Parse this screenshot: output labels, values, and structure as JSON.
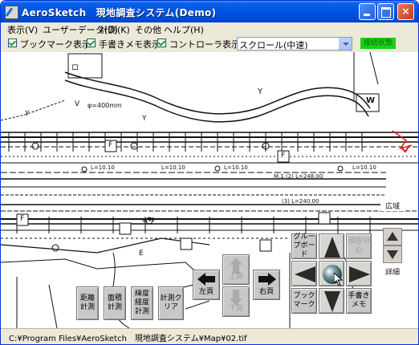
{
  "window": {
    "title": "AeroSketch　現地調査システム(Demo)",
    "controls": {
      "minimize": "minimize",
      "maximize": "maximize",
      "close": "×"
    }
  },
  "menu": [
    "表示(V)",
    "ユーザーデータ(D)",
    "計測(K)",
    "その他",
    "ヘルプ(H)"
  ],
  "toolbar": {
    "bookmark_show": "ブックマーク表示",
    "handwritten_memo_show": "手書きメモ表示",
    "controller_show": "コントローラ表示",
    "scroll_mode": "スクロール(中速)",
    "status_lamp": "接続状態"
  },
  "map": {
    "labels": {
      "y1": "Y",
      "y2": "Y",
      "y3": "Y",
      "w": "W",
      "v": "V",
      "f1": "F",
      "f2": "F",
      "f3": "F",
      "e": "E",
      "dia": "φ=400mm",
      "dim1": "L=10.10",
      "dim2": "L=10.10",
      "dim3": "L=10.10",
      "dim4": "L=10.10",
      "rt1": "M.1.(2) L=248.00",
      "rt2": "(3) L=240.00",
      "ofs": "φ.40",
      "box": "ロ"
    }
  },
  "zoom": {
    "wide": "広域",
    "detail": "詳細"
  },
  "controller": {
    "measure_distance": "距離計測",
    "measure_area": "面積計測",
    "measure_latlon": "緯度経度計測",
    "measure_clear": "計測クリア",
    "left_page": "左頁",
    "up_page": "上頁",
    "down_page": "下頁",
    "right_page": "右頁",
    "group_board": "グループボード",
    "current_center": "現在中心",
    "bookmark": "ブックマーク",
    "handwritten_memo": "手書きメモ"
  },
  "status": {
    "path": "C:¥Program Files¥AeroSketch　現地調査システム¥Map¥02.tif"
  }
}
